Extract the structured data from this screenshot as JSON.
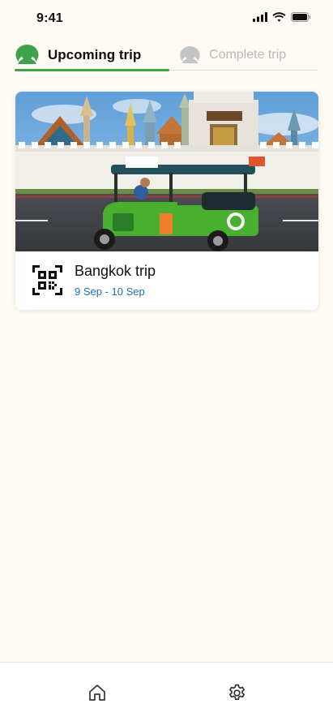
{
  "status_bar": {
    "time": "9:41",
    "icons": [
      "signal-icon",
      "wifi-icon",
      "battery-icon"
    ]
  },
  "tabs": [
    {
      "label": "Upcoming trip",
      "active": true,
      "icon": "avatar-icon"
    },
    {
      "label": "Complete trip",
      "active": false,
      "icon": "avatar-icon"
    }
  ],
  "trip_card": {
    "image": "bangkok-tuk-tuk-photo",
    "icon": "qr-code-icon",
    "title": "Bangkok trip",
    "dates": "9 Sep - 10 Sep"
  },
  "bottom_nav": {
    "items": [
      "home-icon",
      "settings-icon"
    ]
  },
  "colors": {
    "accent": "#3fa34d",
    "link": "#1f6fb5",
    "background": "#fffaf3",
    "inactive": "#b9b9b9"
  }
}
